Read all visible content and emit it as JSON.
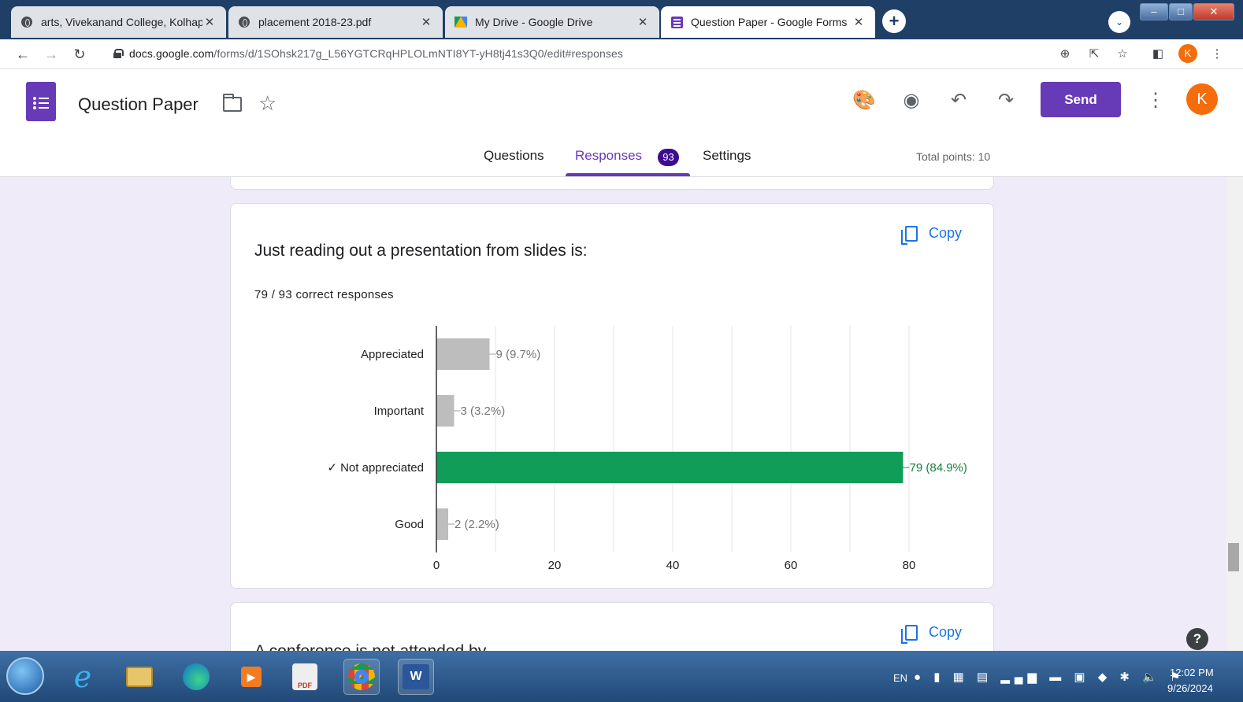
{
  "browser": {
    "tabs": [
      {
        "label": "arts, Vivekanand College, Kolhap",
        "icon": "globe-icon",
        "active": false
      },
      {
        "label": "placement 2018-23.pdf",
        "icon": "globe-icon",
        "active": false
      },
      {
        "label": "My Drive - Google Drive",
        "icon": "google-drive-icon",
        "active": false
      },
      {
        "label": "Question Paper - Google Forms",
        "icon": "google-forms-icon",
        "active": true
      }
    ],
    "new_tab_label": "+",
    "url_host": "docs.google.com",
    "url_path": "/forms/d/1SOhsk217g_L56YGTCRqHPLOLmNTI8YT-yH8tj41s3Q0/edit#responses",
    "profile_initial": "K"
  },
  "forms": {
    "title": "Question Paper",
    "send_label": "Send",
    "avatar_initial": "K",
    "tabs": {
      "questions": "Questions",
      "responses": "Responses",
      "settings": "Settings"
    },
    "responses_count": "93",
    "total_points": "Total points: 10",
    "accent_color": "#673ab7"
  },
  "question": {
    "title": "Just reading out a presentation from slides is:",
    "copy_label": "Copy",
    "correct_summary": "79 / 93 correct responses"
  },
  "next_question": {
    "title": "A conference is not attended by",
    "copy_label": "Copy"
  },
  "chart_data": {
    "type": "bar",
    "orientation": "horizontal",
    "categories": [
      "Appreciated",
      "Important",
      "✓ Not appreciated",
      "Good"
    ],
    "values": [
      9,
      3,
      79,
      2
    ],
    "value_labels": [
      "9 (9.7%)",
      "3 (3.2%)",
      "79 (84.9%)",
      "2 (2.2%)"
    ],
    "correct_index": 2,
    "colors": {
      "correct": "#0f9d58",
      "incorrect": "#bdbdbd",
      "correct_label": "#188038",
      "incorrect_label": "#757575"
    },
    "xlim": [
      0,
      80
    ],
    "xticks": [
      0,
      20,
      40,
      60,
      80
    ],
    "grid": true
  },
  "taskbar": {
    "language": "EN",
    "time": "12:02 PM",
    "date": "9/26/2024"
  }
}
